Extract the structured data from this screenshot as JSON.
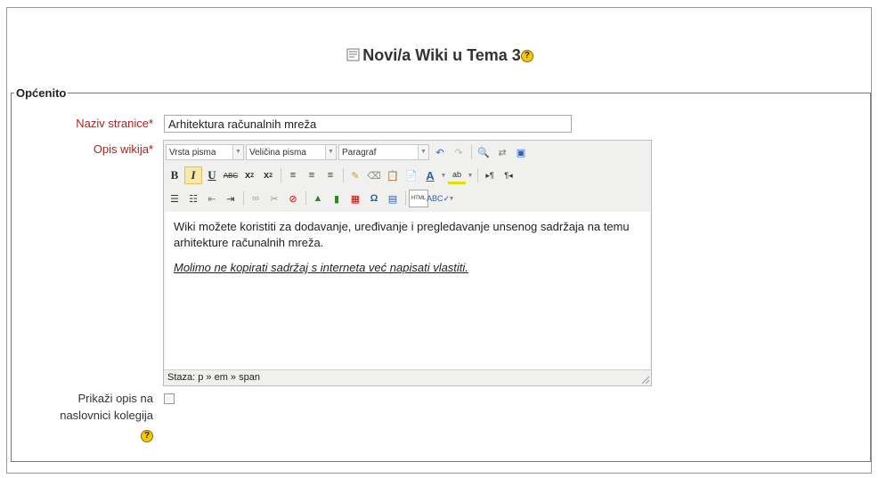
{
  "header": {
    "title": "Novi/a Wiki u Tema 3"
  },
  "section": {
    "legend": "Općenito"
  },
  "form": {
    "page_name_label": "Naziv stranice",
    "page_name_value": "Arhitektura računalnih mreža",
    "description_label": "Opis wikija",
    "required_mark": "*",
    "show_description_label_line1": "Prikaži opis na",
    "show_description_label_line2": "naslovnici kolegija"
  },
  "editor": {
    "font_family": "Vrsta pisma",
    "font_size": "Veličina pisma",
    "paragraph": "Paragraf",
    "content_paragraph": "Wiki možete koristiti za dodavanje, uređivanje i pregledavanje unsenog sadržaja na temu arhitekture računalnih mreža.",
    "content_note": "Molimo ne kopirati sadržaj s interneta već napisati vlastiti.",
    "path": "Staza: p » em » span"
  },
  "colors": {
    "label_red": "#aa2222",
    "help_yellow": "#f5c800"
  }
}
